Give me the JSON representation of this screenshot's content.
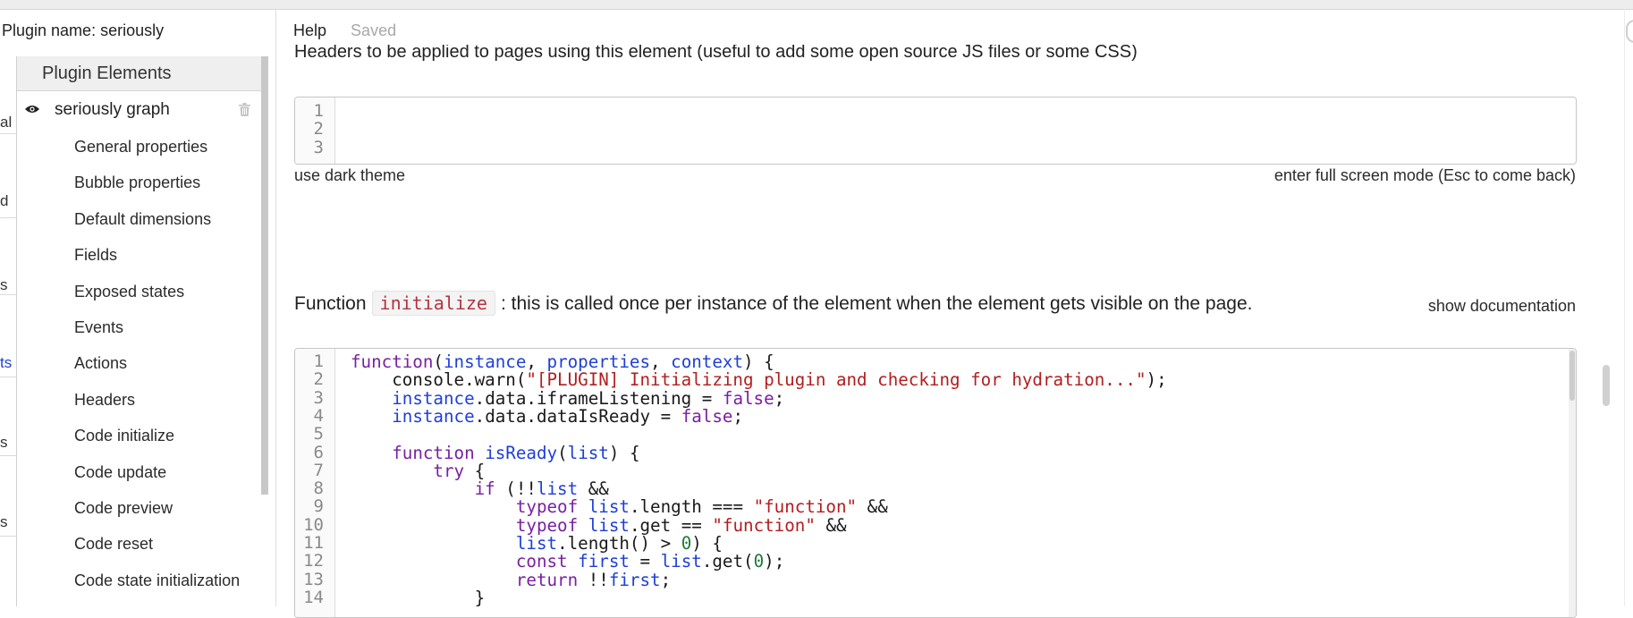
{
  "header": {
    "plugin_name": "Plugin name: seriously",
    "help_label": "Help",
    "saved_label": "Saved"
  },
  "left_fragments": [
    {
      "text": "al"
    },
    {
      "text": "d"
    },
    {
      "text": "s"
    },
    {
      "text": "ts",
      "color": "#1e3fd8"
    },
    {
      "text": "s"
    },
    {
      "text": "s"
    }
  ],
  "sidebar": {
    "header": "Plugin Elements",
    "element_name": "seriously graph",
    "items": [
      "General properties",
      "Bubble properties",
      "Default dimensions",
      "Fields",
      "Exposed states",
      "Events",
      "Actions",
      "Headers",
      "Code initialize",
      "Code update",
      "Code preview",
      "Code reset",
      "Code state initialization"
    ]
  },
  "headers_section": {
    "description": "Headers to be applied to pages using this element (useful to add some open source JS files or some CSS)",
    "line_numbers": [
      "1",
      "2",
      "3"
    ],
    "dark_theme_label": "use dark theme",
    "full_screen_label": "enter full screen mode (Esc to come back)"
  },
  "initialize_section": {
    "prefix": "Function",
    "function_name": "initialize",
    "suffix": ": this is called once per instance of the element when the element gets visible on the page.",
    "show_doc_label": "show documentation",
    "line_numbers": [
      "1",
      "2",
      "3",
      "4",
      "5",
      "6",
      "7",
      "8",
      "9",
      "10",
      "11",
      "12",
      "13",
      "14"
    ],
    "code_lines": [
      [
        {
          "t": "function",
          "c": "kw"
        },
        {
          "t": "("
        },
        {
          "t": "instance",
          "c": "vr"
        },
        {
          "t": ", "
        },
        {
          "t": "properties",
          "c": "vr"
        },
        {
          "t": ", "
        },
        {
          "t": "context",
          "c": "vr"
        },
        {
          "t": ") {"
        }
      ],
      [
        {
          "t": "    console.warn("
        },
        {
          "t": "\"[PLUGIN] Initializing plugin and checking for hydration...\"",
          "c": "st"
        },
        {
          "t": ");"
        }
      ],
      [
        {
          "t": "    "
        },
        {
          "t": "instance",
          "c": "vr"
        },
        {
          "t": ".data.iframeListening = "
        },
        {
          "t": "false",
          "c": "kw"
        },
        {
          "t": ";"
        }
      ],
      [
        {
          "t": "    "
        },
        {
          "t": "instance",
          "c": "vr"
        },
        {
          "t": ".data.dataIsReady = "
        },
        {
          "t": "false",
          "c": "kw"
        },
        {
          "t": ";"
        }
      ],
      [
        {
          "t": ""
        }
      ],
      [
        {
          "t": "    "
        },
        {
          "t": "function",
          "c": "kw"
        },
        {
          "t": " "
        },
        {
          "t": "isReady",
          "c": "vr"
        },
        {
          "t": "("
        },
        {
          "t": "list",
          "c": "vr"
        },
        {
          "t": ") {"
        }
      ],
      [
        {
          "t": "        "
        },
        {
          "t": "try",
          "c": "kw"
        },
        {
          "t": " {"
        }
      ],
      [
        {
          "t": "            "
        },
        {
          "t": "if",
          "c": "kw"
        },
        {
          "t": " (!!"
        },
        {
          "t": "list",
          "c": "vr"
        },
        {
          "t": " &&"
        }
      ],
      [
        {
          "t": "                "
        },
        {
          "t": "typeof",
          "c": "kw"
        },
        {
          "t": " "
        },
        {
          "t": "list",
          "c": "vr"
        },
        {
          "t": ".length === "
        },
        {
          "t": "\"function\"",
          "c": "st"
        },
        {
          "t": " &&"
        }
      ],
      [
        {
          "t": "                "
        },
        {
          "t": "typeof",
          "c": "kw"
        },
        {
          "t": " "
        },
        {
          "t": "list",
          "c": "vr"
        },
        {
          "t": ".get == "
        },
        {
          "t": "\"function\"",
          "c": "st"
        },
        {
          "t": " &&"
        }
      ],
      [
        {
          "t": "                "
        },
        {
          "t": "list",
          "c": "vr"
        },
        {
          "t": ".length() > "
        },
        {
          "t": "0",
          "c": "nm"
        },
        {
          "t": ") {"
        }
      ],
      [
        {
          "t": "                "
        },
        {
          "t": "const",
          "c": "kw"
        },
        {
          "t": " "
        },
        {
          "t": "first",
          "c": "vr"
        },
        {
          "t": " = "
        },
        {
          "t": "list",
          "c": "vr"
        },
        {
          "t": ".get("
        },
        {
          "t": "0",
          "c": "nm"
        },
        {
          "t": ");"
        }
      ],
      [
        {
          "t": "                "
        },
        {
          "t": "return",
          "c": "kw"
        },
        {
          "t": " !!"
        },
        {
          "t": "first",
          "c": "vr"
        },
        {
          "t": ";"
        }
      ],
      [
        {
          "t": "            }"
        }
      ]
    ]
  },
  "icons": {
    "visibility": "eye-icon",
    "delete": "trash-icon"
  }
}
